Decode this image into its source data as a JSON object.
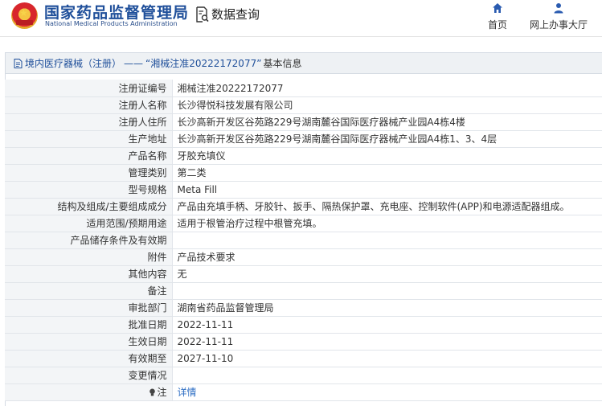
{
  "header": {
    "title": "国家药品监督管理局",
    "subtitle": "National Medical Products Administration",
    "query_label": "数据查询",
    "nav": [
      {
        "label": "首页",
        "icon": "home-icon"
      },
      {
        "label": "网上办事大厅",
        "icon": "user-icon"
      }
    ]
  },
  "breadcrumb": {
    "link": "境内医疗器械（注册）",
    "sep": "——",
    "current": "“湘械注准20222172077”",
    "title": "基本信息"
  },
  "rows": [
    {
      "label": "注册证编号",
      "value": "湘械注准20222172077"
    },
    {
      "label": "注册人名称",
      "value": "长沙得悦科技发展有限公司"
    },
    {
      "label": "注册人住所",
      "value": "长沙高新开发区谷苑路229号湖南麓谷国际医疗器械产业园A4栋4楼"
    },
    {
      "label": "生产地址",
      "value": "长沙高新开发区谷苑路229号湖南麓谷国际医疗器械产业园A4栋1、3、4层"
    },
    {
      "label": "产品名称",
      "value": "牙胶充填仪"
    },
    {
      "label": "管理类别",
      "value": "第二类"
    },
    {
      "label": "型号规格",
      "value": "Meta Fill"
    },
    {
      "label": "结构及组成/主要组成成分",
      "value": "产品由充填手柄、牙胶针、扳手、隔热保护罩、充电座、控制软件(APP)和电源适配器组成。"
    },
    {
      "label": "适用范围/预期用途",
      "value": "适用于根管治疗过程中根管充填。"
    },
    {
      "label": "产品储存条件及有效期",
      "value": ""
    },
    {
      "label": "附件",
      "value": "产品技术要求"
    },
    {
      "label": "其他内容",
      "value": "无"
    },
    {
      "label": "备注",
      "value": ""
    },
    {
      "label": "审批部门",
      "value": "湖南省药品监督管理局"
    },
    {
      "label": "批准日期",
      "value": "2022-11-11"
    },
    {
      "label": "生效日期",
      "value": "2022-11-11"
    },
    {
      "label": "有效期至",
      "value": "2027-11-10"
    },
    {
      "label": "变更情况",
      "value": ""
    }
  ],
  "note_row": {
    "label": "注",
    "value": "详情"
  },
  "colors": {
    "brand_blue": "#1f4f9a",
    "link": "#2f6fc4",
    "label_bg": "#f3f5f7"
  }
}
